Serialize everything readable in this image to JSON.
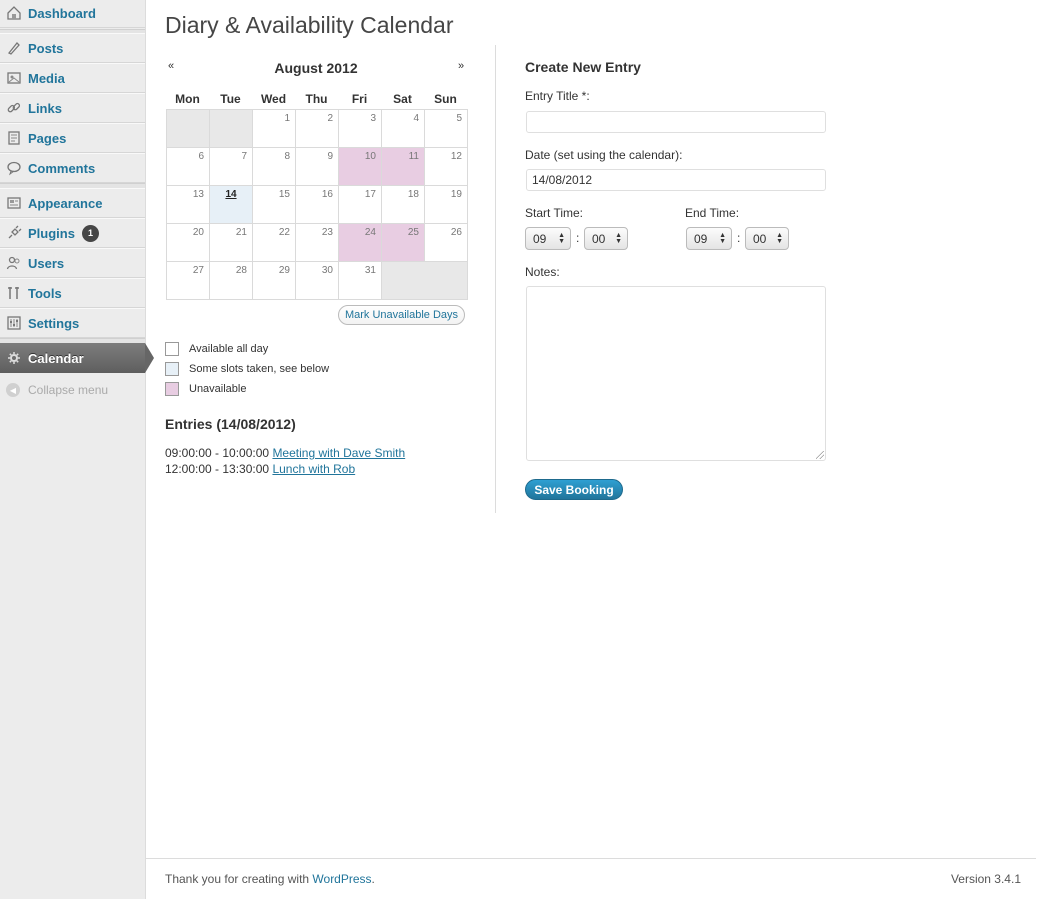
{
  "sidebar": {
    "items": [
      {
        "label": "Dashboard",
        "icon": "dashboard-icon"
      },
      {
        "label": "Posts",
        "icon": "posts-icon"
      },
      {
        "label": "Media",
        "icon": "media-icon"
      },
      {
        "label": "Links",
        "icon": "links-icon"
      },
      {
        "label": "Pages",
        "icon": "pages-icon"
      },
      {
        "label": "Comments",
        "icon": "comments-icon"
      },
      {
        "label": "Appearance",
        "icon": "appearance-icon"
      },
      {
        "label": "Plugins",
        "icon": "plugins-icon",
        "badge": "1"
      },
      {
        "label": "Users",
        "icon": "users-icon"
      },
      {
        "label": "Tools",
        "icon": "tools-icon"
      },
      {
        "label": "Settings",
        "icon": "settings-icon"
      },
      {
        "label": "Calendar",
        "icon": "calendar-gear-icon",
        "active": true
      }
    ],
    "collapse_label": "Collapse menu"
  },
  "page": {
    "title": "Diary & Availability Calendar"
  },
  "calendar": {
    "prev": "«",
    "next": "»",
    "month_label": "August 2012",
    "weekdays": [
      "Mon",
      "Tue",
      "Wed",
      "Thu",
      "Fri",
      "Sat",
      "Sun"
    ],
    "weeks": [
      [
        "",
        "",
        "1",
        "2",
        "3",
        "4",
        "5"
      ],
      [
        "6",
        "7",
        "8",
        "9",
        "10",
        "11",
        "12"
      ],
      [
        "13",
        "14",
        "15",
        "16",
        "17",
        "18",
        "19"
      ],
      [
        "20",
        "21",
        "22",
        "23",
        "24",
        "25",
        "26"
      ],
      [
        "27",
        "28",
        "29",
        "30",
        "31",
        "",
        ""
      ]
    ],
    "unavailable_days": [
      "10",
      "11",
      "24",
      "25"
    ],
    "partial_days": [
      "14"
    ],
    "mark_button": "Mark Unavailable Days",
    "legend": [
      {
        "label": "Available all day",
        "color": "#ffffff"
      },
      {
        "label": "Some slots taken, see below",
        "color": "#e7f0f7"
      },
      {
        "label": "Unavailable",
        "color": "#e8cde2"
      }
    ]
  },
  "entries": {
    "heading": "Entries (14/08/2012)",
    "items": [
      {
        "time": "09:00:00 - 10:00:00",
        "title": "Meeting with Dave Smith"
      },
      {
        "time": "12:00:00 - 13:30:00",
        "title": "Lunch with Rob"
      }
    ]
  },
  "form": {
    "heading": "Create New Entry",
    "title_label": "Entry Title *:",
    "title_value": "",
    "date_label": "Date (set using the calendar):",
    "date_value": "14/08/2012",
    "start_label": "Start Time:",
    "end_label": "End Time:",
    "start_hour": "09",
    "start_min": "00",
    "end_hour": "09",
    "end_min": "00",
    "colon": ":",
    "notes_label": "Notes:",
    "save_label": "Save Booking"
  },
  "footer": {
    "thanks_prefix": "Thank you for creating with ",
    "thanks_link": "WordPress",
    "thanks_suffix": ".",
    "version": "Version 3.4.1"
  },
  "colors": {
    "accent": "#21759b",
    "unavailable": "#e8cde2",
    "partial": "#e7f0f7"
  }
}
